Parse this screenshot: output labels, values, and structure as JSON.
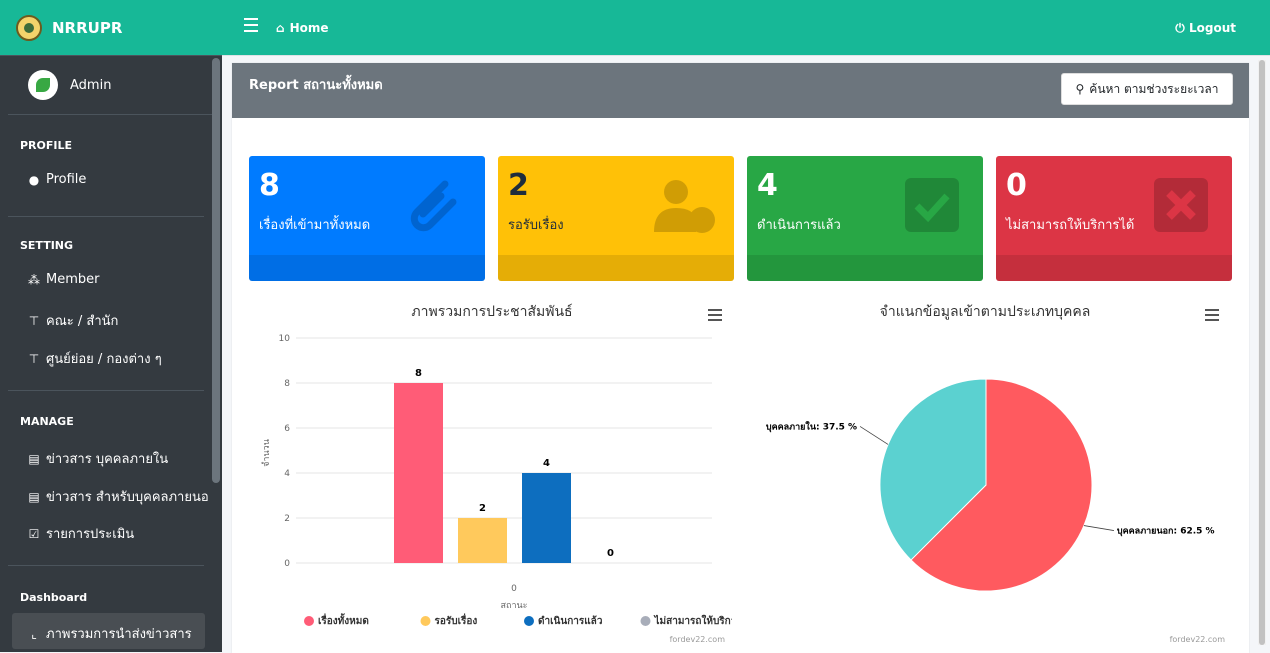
{
  "sidebar": {
    "brand": "NRRUPR",
    "user_name": "Admin",
    "sections": {
      "profile": "PROFILE",
      "setting": "SETTING",
      "manage": "MANAGE",
      "dashboard": "Dashboard"
    },
    "items": {
      "profile": "Profile",
      "member": "Member",
      "faculty": "คณะ / สำนัก",
      "centers": "ศูนย์ย่อย / กองต่าง ๆ",
      "news_internal": "ข่าวสาร บุคคลภายใน",
      "news_external": "ข่าวสาร สำหรับบุคคลภายนอ",
      "evaluation": "รายการประเมิน",
      "overview": "ภาพรวมการนำส่งข่าวสาร"
    }
  },
  "topbar": {
    "home": "Home",
    "logout": "Logout"
  },
  "report": {
    "title": "Report สถานะทั้งหมด",
    "search_button": "ค้นหา ตามช่วงระยะเวลา"
  },
  "stats": [
    {
      "value": "8",
      "label": "เรื่องที่เข้ามาทั้งหมด",
      "icon": "paperclip-icon",
      "color": "#007bff"
    },
    {
      "value": "2",
      "label": "รอรับเรื่อง",
      "icon": "user-clock-icon",
      "color": "#ffc107"
    },
    {
      "value": "4",
      "label": "ดำเนินการแล้ว",
      "icon": "check-square-icon",
      "color": "#28a745"
    },
    {
      "value": "0",
      "label": "ไม่สามารถให้บริการได้",
      "icon": "times-square-icon",
      "color": "#dc3545"
    }
  ],
  "chart_data": [
    {
      "type": "bar",
      "title": "ภาพรวมการประชาสัมพันธ์",
      "xlabel": "สถานะ",
      "ylabel": "จำนวน",
      "categories": [
        "0"
      ],
      "ylim": [
        0,
        10
      ],
      "yticks": [
        0,
        2,
        4,
        6,
        8,
        10
      ],
      "grid": true,
      "legend": "bottom",
      "credit": "fordev22.com",
      "series": [
        {
          "name": "เรื่องทั้งหมด",
          "values": [
            8
          ],
          "color": "#ff5c77"
        },
        {
          "name": "รอรับเรื่อง",
          "values": [
            2
          ],
          "color": "#ffc95c"
        },
        {
          "name": "ดำเนินการแล้ว",
          "values": [
            4
          ],
          "color": "#0d6ebf"
        },
        {
          "name": "ไม่สามารถให้บริการได้",
          "values": [
            0
          ],
          "color": "#a8adb9"
        }
      ]
    },
    {
      "type": "pie",
      "title": "จำแนกข้อมูลเข้าตามประเภทบุคคล",
      "credit": "fordev22.com",
      "slices": [
        {
          "name": "บุคคลภายนอก",
          "value": 62.5,
          "label": "บุคคลภายนอก: 62.5 %",
          "color": "#ff5a5f"
        },
        {
          "name": "บุคคลภายใน",
          "value": 37.5,
          "label": "บุคคลภายใน: 37.5 %",
          "color": "#5bd1d0"
        }
      ]
    }
  ]
}
